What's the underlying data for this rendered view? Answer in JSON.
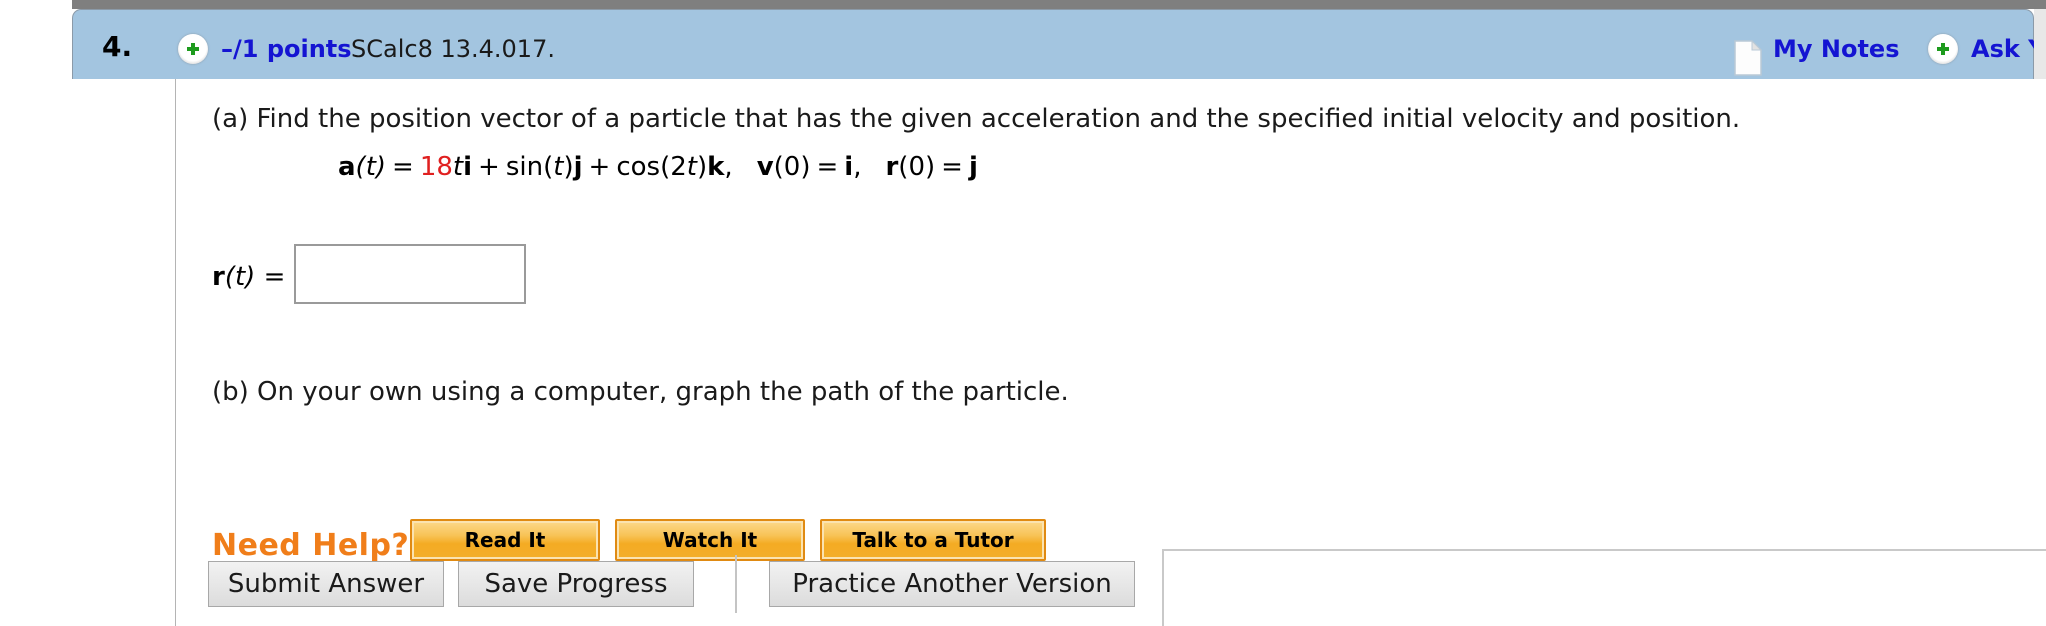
{
  "header": {
    "question_number": "4.",
    "points": "–/1 points",
    "problem_id": "SCalc8 13.4.017.",
    "my_notes_label": "My Notes",
    "ask_your_label": "Ask Your",
    "add_icon": "green-plus-icon",
    "notes_icon": "document-page-icon",
    "background_color": "#a3c5e0",
    "link_color": "#1414d2"
  },
  "question": {
    "part_a": "(a) Find the position vector of a particle that has the given acceleration and the specified initial velocity and position.",
    "part_b": "(b) On your own using a computer, graph the path of the particle.",
    "equation": {
      "a_label": "a",
      "a_arg": "(t)",
      "equals": "=",
      "coef": "18",
      "coef_color": "#e02020",
      "term1_var": "t",
      "term1_unit": "i",
      "plus1": "+",
      "term2": "sin(t)",
      "term2_unit": "j",
      "plus2": "+",
      "term3": "cos(2t)",
      "term3_unit": "k",
      "comma1": ",",
      "v_label": "v",
      "v_arg": "(0)",
      "v_equals": "=",
      "v_value": "i",
      "comma2": ",",
      "r_label": "r",
      "r_arg": "(0)",
      "r_equals": "=",
      "r_value": "j",
      "plain": "a(t) = 18t i + sin(t) j + cos(2t) k,   v(0) = i,   r(0) = j"
    },
    "answer_label_r": "r",
    "answer_label_arg": "(t) =",
    "answer_value": "",
    "answer_placeholder": ""
  },
  "need_help": {
    "label": "Need Help?",
    "label_color": "#f07e1a",
    "buttons": [
      {
        "label": "Read It"
      },
      {
        "label": "Watch It"
      },
      {
        "label": "Talk to a Tutor"
      }
    ]
  },
  "actions": {
    "submit_label": "Submit Answer",
    "save_label": "Save Progress",
    "practice_label": "Practice Another Version"
  }
}
